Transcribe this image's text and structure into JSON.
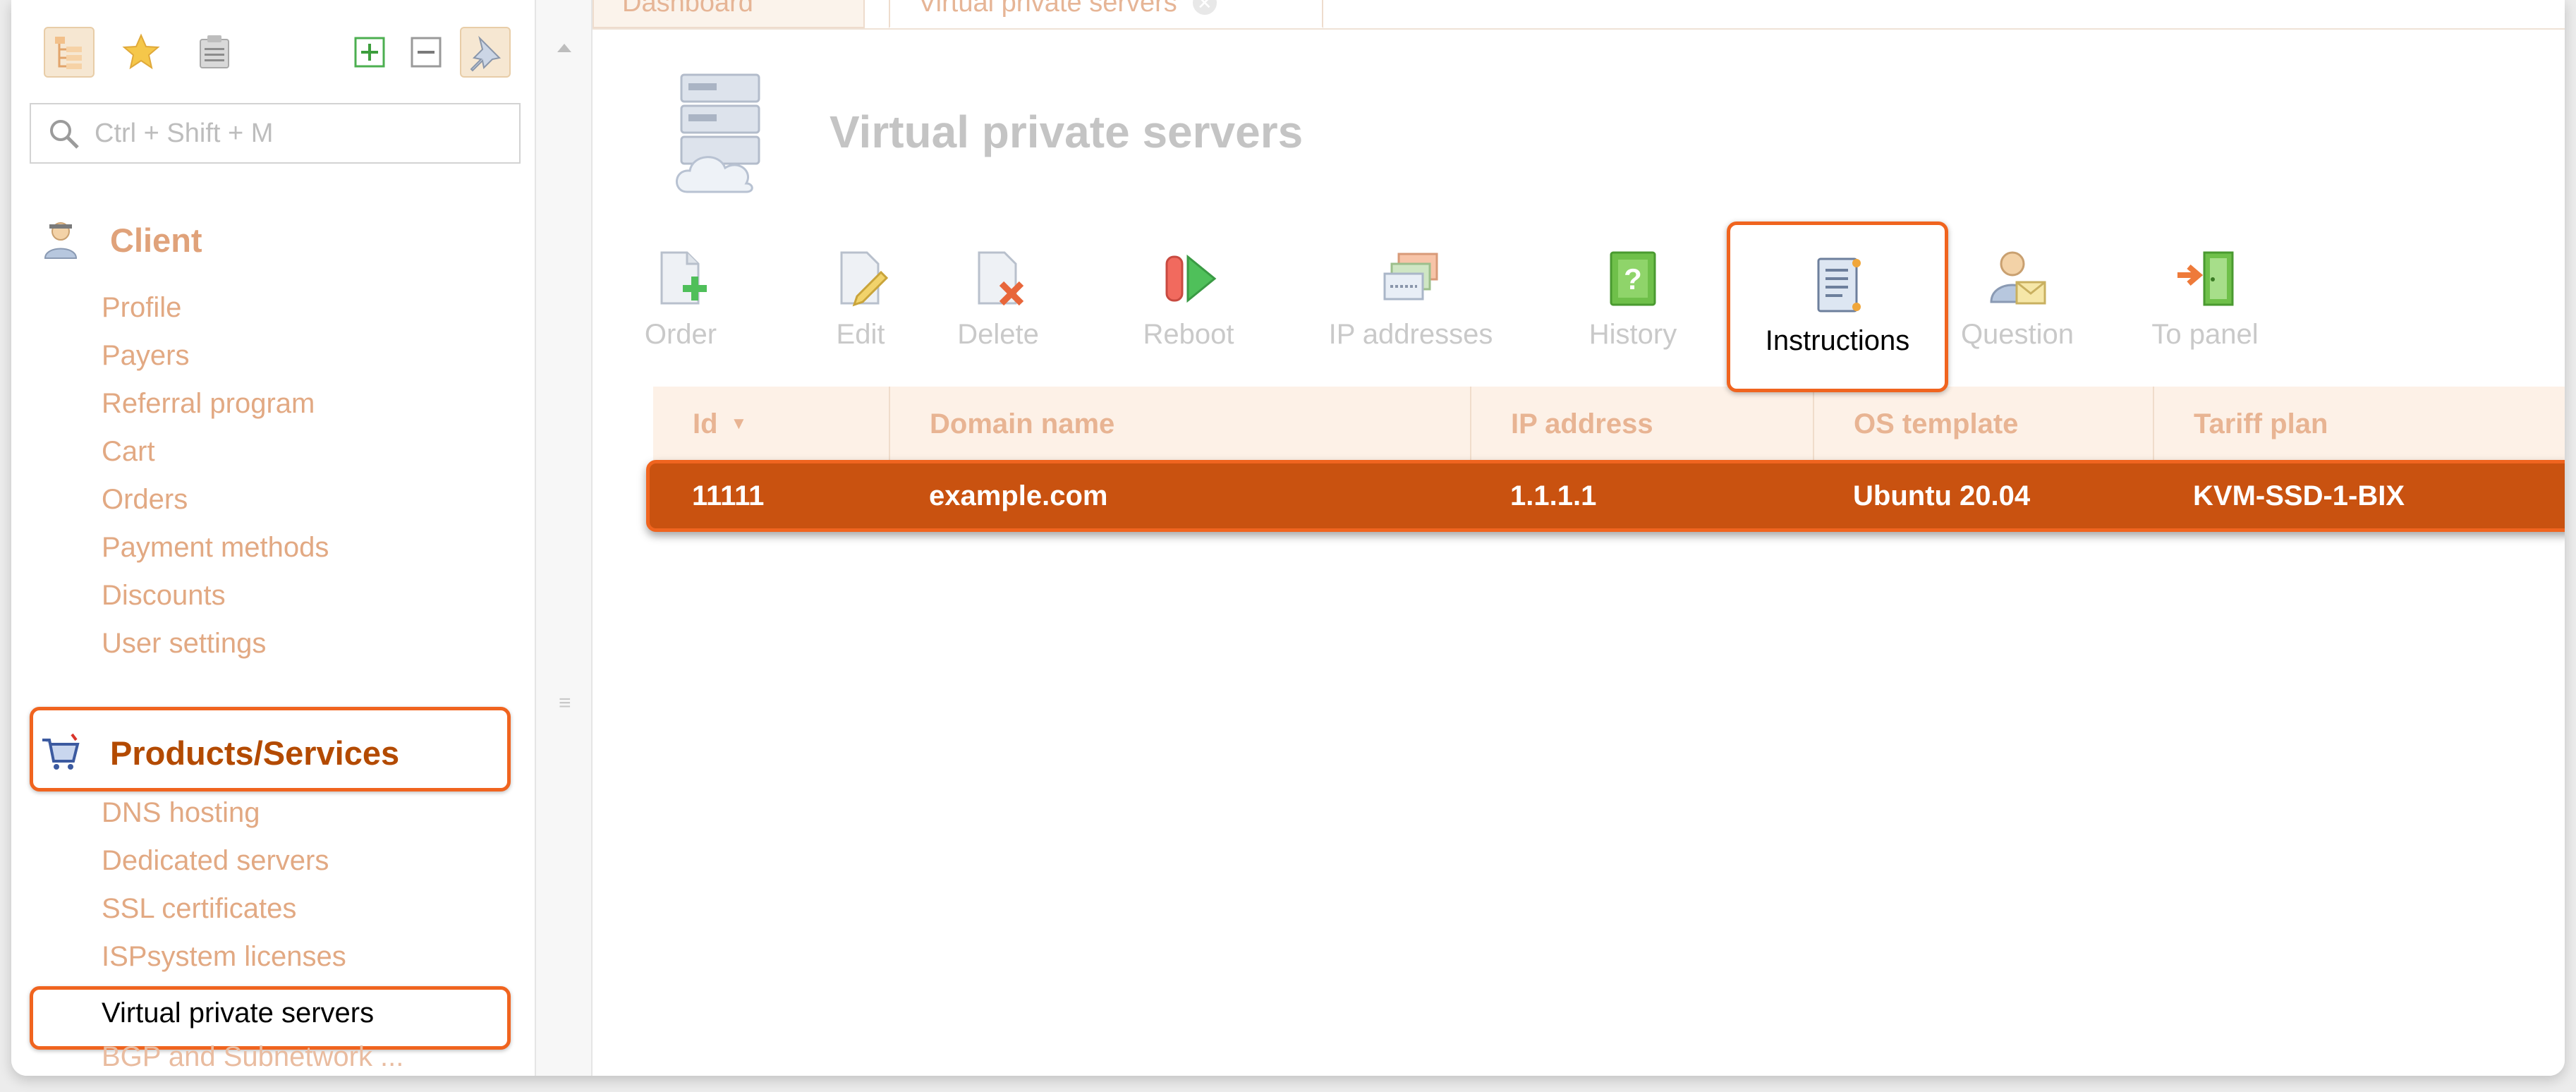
{
  "sidebar": {
    "search_placeholder": "Ctrl + Shift + M",
    "client": {
      "title": "Client",
      "items": [
        "Profile",
        "Payers",
        "Referral program",
        "Cart",
        "Orders",
        "Payment methods",
        "Discounts",
        "User settings"
      ]
    },
    "products": {
      "title": "Products/Services",
      "items": [
        "DNS hosting",
        "Dedicated servers",
        "SSL certificates",
        "ISPsystem licenses",
        "Virtual private servers",
        "BGP and Subnetwork ..."
      ]
    }
  },
  "tabs": [
    "Dashboard",
    "Virtual private servers"
  ],
  "page": {
    "title": "Virtual private servers"
  },
  "toolbar": [
    "Order",
    "Edit",
    "Delete",
    "Reboot",
    "IP addresses",
    "History",
    "Instructions",
    "Question",
    "To panel"
  ],
  "table": {
    "columns": [
      "Id",
      "Domain name",
      "IP address",
      "OS template",
      "Tariff plan"
    ],
    "rows": [
      [
        "11111",
        "example.com",
        "1.1.1.1",
        "Ubuntu 20.04",
        "KVM-SSD-1-BIX"
      ]
    ]
  },
  "colors": {
    "accent": "#f0641f",
    "selected_row": "#c95210",
    "group_title": "#b34a00"
  }
}
